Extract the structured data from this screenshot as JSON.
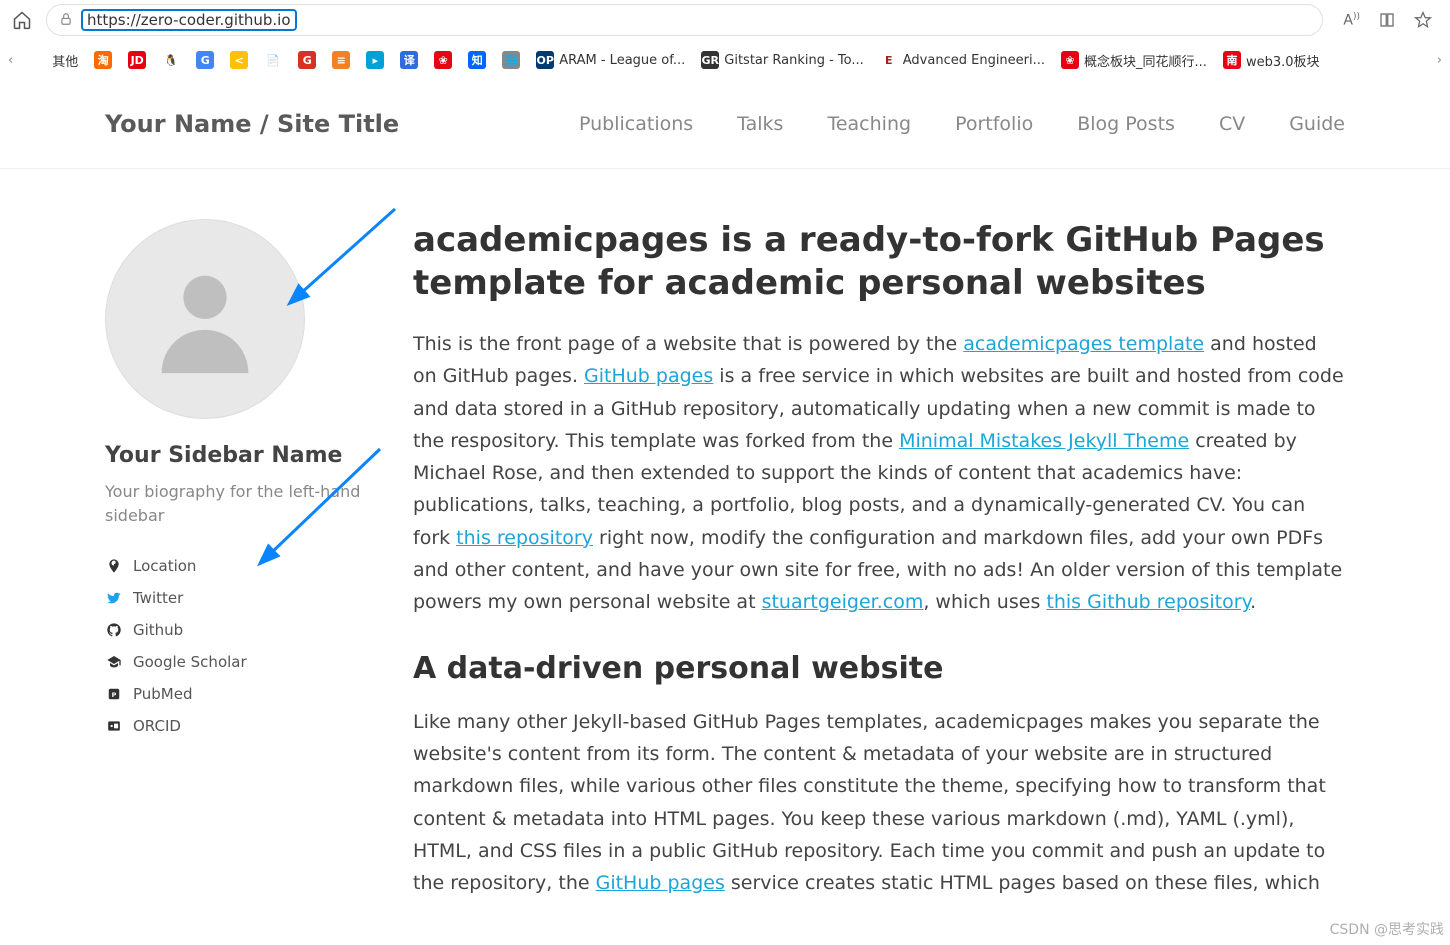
{
  "browser": {
    "url": "https://zero-coder.github.io"
  },
  "bookmarks": [
    {
      "label": "其他",
      "bg": "#fff",
      "txt": "",
      "color": "#333"
    },
    {
      "label": "",
      "bg": "#ff6a00",
      "txt": "淘"
    },
    {
      "label": "",
      "bg": "#e60012",
      "txt": "JD"
    },
    {
      "label": "",
      "bg": "#fff",
      "txt": "🐧",
      "color": "#333"
    },
    {
      "label": "",
      "bg": "#4285f4",
      "txt": "G"
    },
    {
      "label": "",
      "bg": "#ffc107",
      "txt": "<"
    },
    {
      "label": "",
      "bg": "#fff",
      "txt": "📄",
      "color": "#333"
    },
    {
      "label": "",
      "bg": "#d93025",
      "txt": "G"
    },
    {
      "label": "",
      "bg": "#f48024",
      "txt": "≡"
    },
    {
      "label": "",
      "bg": "#00a1d6",
      "txt": "▸"
    },
    {
      "label": "",
      "bg": "#2f6cde",
      "txt": "译"
    },
    {
      "label": "",
      "bg": "#e30613",
      "txt": "❀"
    },
    {
      "label": "",
      "bg": "#0066ff",
      "txt": "知"
    },
    {
      "label": "",
      "bg": "#888",
      "txt": "🌐"
    },
    {
      "label": "ARAM - League of...",
      "bg": "#003a70",
      "txt": "OP"
    },
    {
      "label": "Gitstar Ranking - To...",
      "bg": "#333",
      "txt": "GR"
    },
    {
      "label": "Advanced Engineeri...",
      "bg": "#fff",
      "txt": "E",
      "color": "#b31b1b"
    },
    {
      "label": "概念板块_同花顺行...",
      "bg": "#e60012",
      "txt": "❀"
    },
    {
      "label": "web3.0板块",
      "bg": "#e60012",
      "txt": "南"
    }
  ],
  "header": {
    "title": "Your Name / Site Title",
    "nav": [
      "Publications",
      "Talks",
      "Teaching",
      "Portfolio",
      "Blog Posts",
      "CV",
      "Guide"
    ]
  },
  "sidebar": {
    "name": "Your Sidebar Name",
    "bio": "Your biography for the left-hand sidebar",
    "links": [
      {
        "icon": "pin",
        "label": "Location"
      },
      {
        "icon": "twitter",
        "label": "Twitter"
      },
      {
        "icon": "github",
        "label": "Github"
      },
      {
        "icon": "scholar",
        "label": "Google Scholar"
      },
      {
        "icon": "pubmed",
        "label": "PubMed"
      },
      {
        "icon": "orcid",
        "label": "ORCID"
      }
    ]
  },
  "main": {
    "h1": "academicpages is a ready-to-fork GitHub Pages template for academic personal websites",
    "p1a": "This is the front page of a website that is powered by the ",
    "p1_link1": "academicpages template",
    "p1b": " and hosted on GitHub pages. ",
    "p1_link2": "GitHub pages",
    "p1c": " is a free service in which websites are built and hosted from code and data stored in a GitHub repository, automatically updating when a new commit is made to the respository. This template was forked from the ",
    "p1_link3": "Minimal Mistakes Jekyll Theme",
    "p1d": " created by Michael Rose, and then extended to support the kinds of content that academics have: publications, talks, teaching, a portfolio, blog posts, and a dynamically-generated CV. You can fork ",
    "p1_link4": "this repository",
    "p1e": " right now, modify the configuration and markdown files, add your own PDFs and other content, and have your own site for free, with no ads! An older version of this template powers my own personal website at ",
    "p1_link5": "stuartgeiger.com",
    "p1f": ", which uses ",
    "p1_link6": "this Github repository",
    "p1g": ".",
    "h2": "A data-driven personal website",
    "p2a": "Like many other Jekyll-based GitHub Pages templates, academicpages makes you separate the website's content from its form. The content & metadata of your website are in structured markdown files, while various other files constitute the theme, specifying how to transform that content & metadata into HTML pages. You keep these various markdown (.md), YAML (.yml), HTML, and CSS files in a public GitHub repository. Each time you commit and push an update to the repository, the ",
    "p2_link1": "GitHub pages",
    "p2b": " service creates static HTML pages based on these files, which"
  },
  "watermark": "CSDN @思考实践"
}
